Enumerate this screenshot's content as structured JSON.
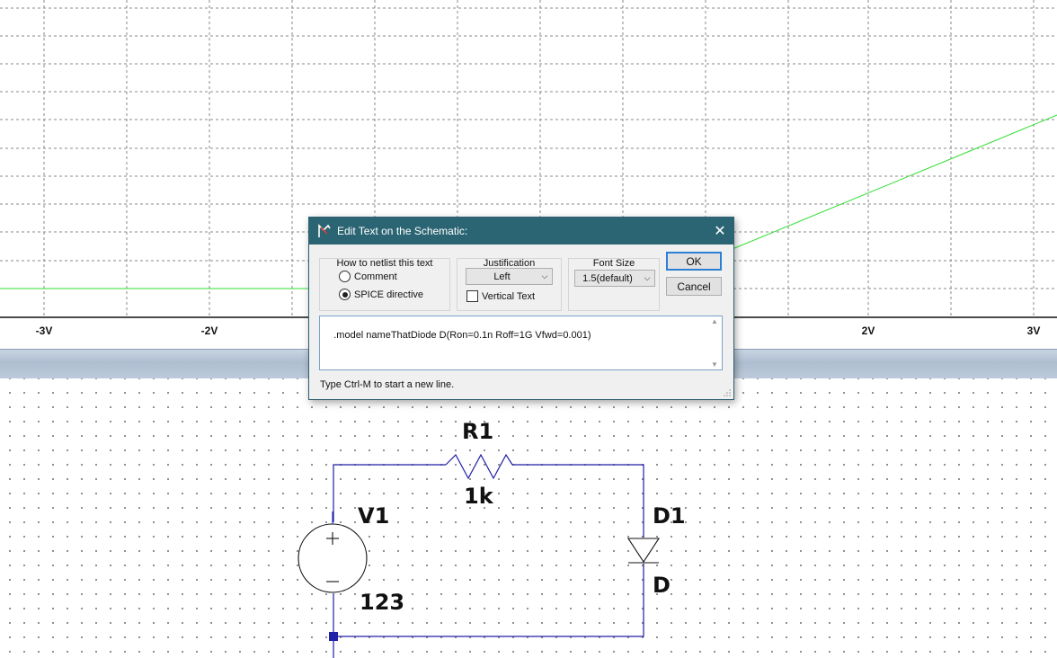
{
  "plot": {
    "axis_labels": [
      "-3V",
      "-2V",
      "2V",
      "3V"
    ],
    "trace_color": "#33dd33"
  },
  "dialog": {
    "title": "Edit Text on the Schematic:",
    "netlist_group": {
      "label": "How to netlist this text",
      "options": [
        "Comment",
        "SPICE directive"
      ],
      "selected": "SPICE directive"
    },
    "justification": {
      "label": "Justification",
      "value": "Left",
      "vertical_text_label": "Vertical Text",
      "vertical_text_checked": false
    },
    "font_size": {
      "label": "Font Size",
      "value": "1.5(default)"
    },
    "ok_label": "OK",
    "cancel_label": "Cancel",
    "text_value": ".model nameThatDiode D(Ron=0.1n Roff=1G Vfwd=0.001)",
    "hint": "Type Ctrl-M to start a new line."
  },
  "schematic": {
    "resistor": {
      "name": "R1",
      "value": "1k"
    },
    "source": {
      "name": "V1",
      "value": "123"
    },
    "diode": {
      "name": "D1",
      "value": "D"
    },
    "wire_color": "#1f1fa8"
  }
}
